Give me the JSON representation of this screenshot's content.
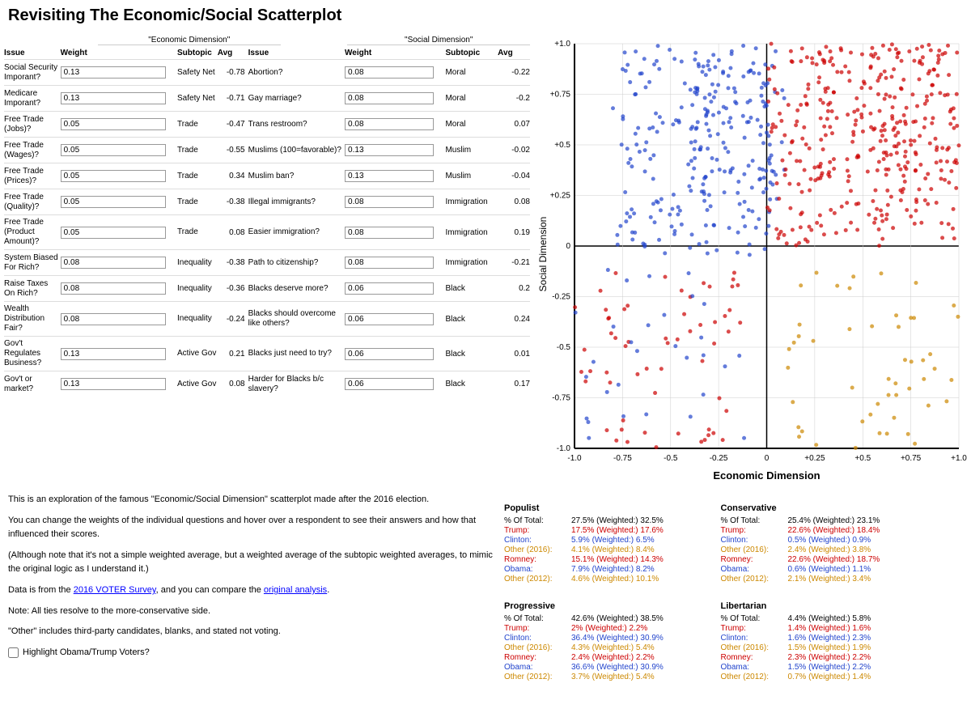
{
  "title": "Revisiting The Economic/Social Scatterplot",
  "econ_header": "\"Economic Dimension\"",
  "social_header": "\"Social Dimension\"",
  "col_labels": {
    "issue": "Issue",
    "weight": "Weight",
    "subtopic": "Subtopic",
    "avg": "Avg"
  },
  "rows": [
    {
      "issue1": "Social Security Imporant?",
      "weight1": "0.13",
      "subtopic1": "Safety Net",
      "avg1": "-0.78",
      "issue2": "Abortion?",
      "weight2": "0.08",
      "subtopic2": "Moral",
      "avg2": "-0.22"
    },
    {
      "issue1": "Medicare Imporant?",
      "weight1": "0.13",
      "subtopic1": "Safety Net",
      "avg1": "-0.71",
      "issue2": "Gay marriage?",
      "weight2": "0.08",
      "subtopic2": "Moral",
      "avg2": "-0.2"
    },
    {
      "issue1": "Free Trade (Jobs)?",
      "weight1": "0.05",
      "subtopic1": "Trade",
      "avg1": "-0.47",
      "issue2": "Trans restroom?",
      "weight2": "0.08",
      "subtopic2": "Moral",
      "avg2": "0.07"
    },
    {
      "issue1": "Free Trade (Wages)?",
      "weight1": "0.05",
      "subtopic1": "Trade",
      "avg1": "-0.55",
      "issue2": "Muslims (100=favorable)?",
      "weight2": "0.13",
      "subtopic2": "Muslim",
      "avg2": "-0.02"
    },
    {
      "issue1": "Free Trade (Prices)?",
      "weight1": "0.05",
      "subtopic1": "Trade",
      "avg1": "0.34",
      "issue2": "Muslim ban?",
      "weight2": "0.13",
      "subtopic2": "Muslim",
      "avg2": "-0.04"
    },
    {
      "issue1": "Free Trade (Quality)?",
      "weight1": "0.05",
      "subtopic1": "Trade",
      "avg1": "-0.38",
      "issue2": "Illegal immigrants?",
      "weight2": "0.08",
      "subtopic2": "Immigration",
      "avg2": "0.08"
    },
    {
      "issue1": "Free Trade (Product Amount)?",
      "weight1": "0.05",
      "subtopic1": "Trade",
      "avg1": "0.08",
      "issue2": "Easier immigration?",
      "weight2": "0.08",
      "subtopic2": "Immigration",
      "avg2": "0.19"
    },
    {
      "issue1": "System Biased For Rich?",
      "weight1": "0.08",
      "subtopic1": "Inequality",
      "avg1": "-0.38",
      "issue2": "Path to citizenship?",
      "weight2": "0.08",
      "subtopic2": "Immigration",
      "avg2": "-0.21"
    },
    {
      "issue1": "Raise Taxes On Rich?",
      "weight1": "0.08",
      "subtopic1": "Inequality",
      "avg1": "-0.36",
      "issue2": "Blacks deserve more?",
      "weight2": "0.06",
      "subtopic2": "Black",
      "avg2": "0.2"
    },
    {
      "issue1": "Wealth Distribution Fair?",
      "weight1": "0.08",
      "subtopic1": "Inequality",
      "avg1": "-0.24",
      "issue2": "Blacks should overcome like others?",
      "weight2": "0.06",
      "subtopic2": "Black",
      "avg2": "0.24"
    },
    {
      "issue1": "Gov't Regulates Business?",
      "weight1": "0.13",
      "subtopic1": "Active Gov",
      "avg1": "0.21",
      "issue2": "Blacks just need to try?",
      "weight2": "0.06",
      "subtopic2": "Black",
      "avg2": "0.01"
    },
    {
      "issue1": "Gov't or market?",
      "weight1": "0.13",
      "subtopic1": "Active Gov",
      "avg1": "0.08",
      "issue2": "Harder for Blacks b/c slavery?",
      "weight2": "0.06",
      "subtopic2": "Black",
      "avg2": "0.17"
    }
  ],
  "scatter": {
    "y_label": "Social Dimension",
    "x_label": "Economic Dimension",
    "y_ticks": [
      "+1.0",
      "+0.75",
      "+0.5",
      "+0.25",
      "0",
      "-0.25",
      "-0.5",
      "-0.75",
      "-1.0"
    ],
    "x_ticks": [
      "-1.0",
      "-0.75",
      "-0.5",
      "-0.25",
      "0",
      "+0.25",
      "+0.5",
      "+0.75",
      "+1.0"
    ]
  },
  "description": {
    "p1": "This is an exploration of the famous \"Economic/Social Dimension\" scatterplot made after the 2016 election.",
    "p2": "You can change the weights of the individual questions and hover over a respondent to see their answers and how that influenced their scores.",
    "p3": "(Although note that it's not a simple weighted average, but a weighted average of the subtopic weighted averages, to mimic the original logic as I understand it.)",
    "p4_prefix": "Data is from the ",
    "p4_link1": "2016 VOTER Survey",
    "p4_mid": ", and you can compare the ",
    "p4_link2": "original analysis",
    "p4_suffix": ".",
    "p5": "Note: All ties resolve to the more-conservative side.",
    "p6": "\"Other\" includes third-party candidates, blanks, and stated not voting.",
    "checkbox_label": "Highlight Obama/Trump Voters?"
  },
  "quadrants": {
    "populist": {
      "title": "Populist",
      "rows": [
        {
          "label": "% Of Total:",
          "val": "27.5% (Weighted:)",
          "val2": "32.5%"
        },
        {
          "label": "Trump:",
          "val": "17.5% (Weighted:)",
          "val2": "17.6%",
          "colored": true
        },
        {
          "label": "Clinton:",
          "val": "5.9% (Weighted:)",
          "val2": "6.5%",
          "colored": true
        },
        {
          "label": "Other (2016):",
          "val": "4.1% (Weighted:)",
          "val2": "8.4%",
          "colored": true
        },
        {
          "label": "Romney:",
          "val": "15.1% (Weighted:)",
          "val2": "14.3%",
          "colored": true
        },
        {
          "label": "Obama:",
          "val": "7.9% (Weighted:)",
          "val2": "8.2%",
          "colored": true
        },
        {
          "label": "Other (2012):",
          "val": "4.6% (Weighted:)",
          "val2": "10.1%",
          "colored": true
        }
      ]
    },
    "conservative": {
      "title": "Conservative",
      "rows": [
        {
          "label": "% Of Total:",
          "val": "25.4% (Weighted:)",
          "val2": "23.1%"
        },
        {
          "label": "Trump:",
          "val": "22.6% (Weighted:)",
          "val2": "18.4%",
          "colored": true
        },
        {
          "label": "Clinton:",
          "val": "0.5% (Weighted:)",
          "val2": "0.9%",
          "colored": true
        },
        {
          "label": "Other (2016):",
          "val": "2.4% (Weighted:)",
          "val2": "3.8%",
          "colored": true
        },
        {
          "label": "Romney:",
          "val": "22.6% (Weighted:)",
          "val2": "18.7%",
          "colored": true
        },
        {
          "label": "Obama:",
          "val": "0.6% (Weighted:)",
          "val2": "1.1%",
          "colored": true
        },
        {
          "label": "Other (2012):",
          "val": "2.1% (Weighted:)",
          "val2": "3.4%",
          "colored": true
        }
      ]
    },
    "progressive": {
      "title": "Progressive",
      "rows": [
        {
          "label": "% Of Total:",
          "val": "42.6% (Weighted:)",
          "val2": "38.5%"
        },
        {
          "label": "Trump:",
          "val": "2% (Weighted:)",
          "val2": "2.2%",
          "colored": true
        },
        {
          "label": "Clinton:",
          "val": "36.4% (Weighted:)",
          "val2": "30.9%",
          "colored": true
        },
        {
          "label": "Other (2016):",
          "val": "4.3% (Weighted:)",
          "val2": "5.4%",
          "colored": true
        },
        {
          "label": "Romney:",
          "val": "2.4% (Weighted:)",
          "val2": "2.2%",
          "colored": true
        },
        {
          "label": "Obama:",
          "val": "36.6% (Weighted:)",
          "val2": "30.9%",
          "colored": true
        },
        {
          "label": "Other (2012):",
          "val": "3.7% (Weighted:)",
          "val2": "5.4%",
          "colored": true
        }
      ]
    },
    "libertarian": {
      "title": "Libertarian",
      "rows": [
        {
          "label": "% Of Total:",
          "val": "4.4% (Weighted:)",
          "val2": "5.8%"
        },
        {
          "label": "Trump:",
          "val": "1.4% (Weighted:)",
          "val2": "1.6%",
          "colored": true
        },
        {
          "label": "Clinton:",
          "val": "1.6% (Weighted:)",
          "val2": "2.3%",
          "colored": true
        },
        {
          "label": "Other (2016):",
          "val": "1.5% (Weighted:)",
          "val2": "1.9%",
          "colored": true
        },
        {
          "label": "Romney:",
          "val": "2.3% (Weighted:)",
          "val2": "2.2%",
          "colored": true
        },
        {
          "label": "Obama:",
          "val": "1.5% (Weighted:)",
          "val2": "2.2%",
          "colored": true
        },
        {
          "label": "Other (2012):",
          "val": "0.7% (Weighted:)",
          "val2": "1.4%",
          "colored": true
        }
      ]
    }
  }
}
